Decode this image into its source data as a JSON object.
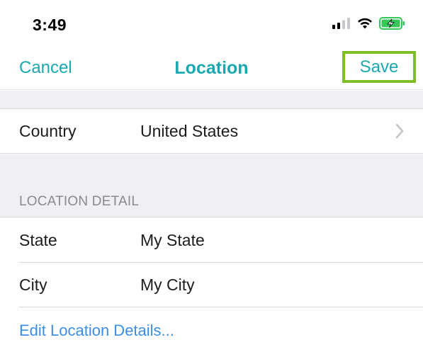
{
  "status_bar": {
    "time": "3:49",
    "icons": [
      "cellular-signal-icon",
      "wifi-icon",
      "battery-charging-icon"
    ]
  },
  "nav": {
    "cancel_label": "Cancel",
    "title": "Location",
    "save_label": "Save"
  },
  "country": {
    "label": "Country",
    "value": "United States"
  },
  "location_detail": {
    "header": "LOCATION DETAIL",
    "state": {
      "label": "State",
      "value": "My State"
    },
    "city": {
      "label": "City",
      "value": "My City"
    }
  },
  "edit_link": "Edit Location Details...",
  "colors": {
    "accent_teal": "#1aa9b0",
    "highlight_green": "#7fbe26",
    "link_blue": "#3a8ee6",
    "battery_green": "#34c759"
  }
}
